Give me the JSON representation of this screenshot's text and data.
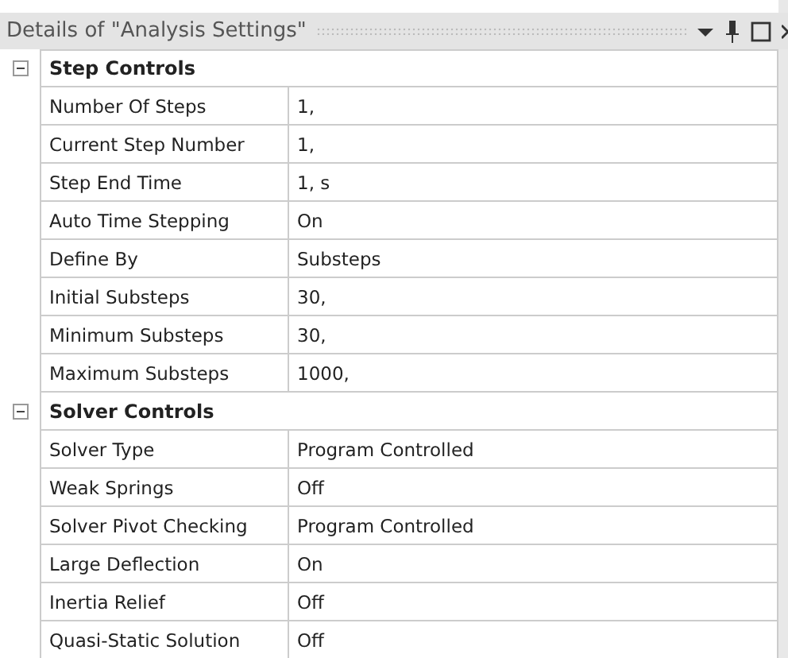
{
  "panel": {
    "title": "Details of \"Analysis Settings\""
  },
  "groups": [
    {
      "name": "Step Controls",
      "expanded": true,
      "rows": [
        {
          "label": "Number Of Steps",
          "value": "1,"
        },
        {
          "label": "Current Step Number",
          "value": "1,"
        },
        {
          "label": "Step End Time",
          "value": "1, s"
        },
        {
          "label": "Auto Time Stepping",
          "value": "On"
        },
        {
          "label": "Define By",
          "value": "Substeps"
        },
        {
          "label": "Initial Substeps",
          "value": "30,"
        },
        {
          "label": "Minimum Substeps",
          "value": "30,"
        },
        {
          "label": "Maximum Substeps",
          "value": "1000,"
        }
      ]
    },
    {
      "name": "Solver Controls",
      "expanded": true,
      "rows": [
        {
          "label": "Solver Type",
          "value": "Program Controlled"
        },
        {
          "label": "Weak Springs",
          "value": "Off"
        },
        {
          "label": "Solver Pivot Checking",
          "value": "Program Controlled"
        },
        {
          "label": "Large Deflection",
          "value": "On"
        },
        {
          "label": "Inertia Relief",
          "value": "Off"
        },
        {
          "label": "Quasi-Static Solution",
          "value": "Off"
        }
      ]
    }
  ]
}
